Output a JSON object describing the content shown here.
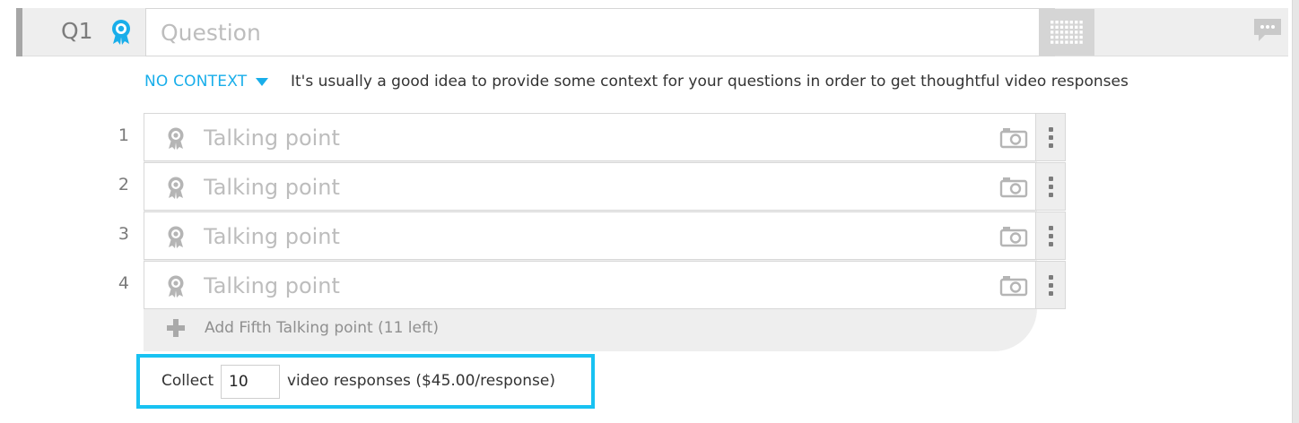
{
  "question": {
    "label": "Q1",
    "placeholder": "Question",
    "badge_icon": "award-ribbon-icon",
    "grid_icon": "keypad-grid-icon",
    "comment_icon": "speech-bubble-icon"
  },
  "context": {
    "dropdown_label": "NO CONTEXT",
    "hint": "It's usually a good idea to provide some context for your questions in order to get thoughtful video responses"
  },
  "talking_points": [
    {
      "number": "1",
      "placeholder": "Talking point"
    },
    {
      "number": "2",
      "placeholder": "Talking point"
    },
    {
      "number": "3",
      "placeholder": "Talking point"
    },
    {
      "number": "4",
      "placeholder": "Talking point"
    }
  ],
  "add_talking_point": {
    "label": "Add Fifth Talking point (11 left)"
  },
  "collect": {
    "label": "Collect",
    "value": "10",
    "suffix": "video responses ($45.00/response)"
  },
  "colors": {
    "accent_blue": "#19aeea",
    "highlight_border": "#18c2f2",
    "panel_gray": "#eeeeee"
  }
}
